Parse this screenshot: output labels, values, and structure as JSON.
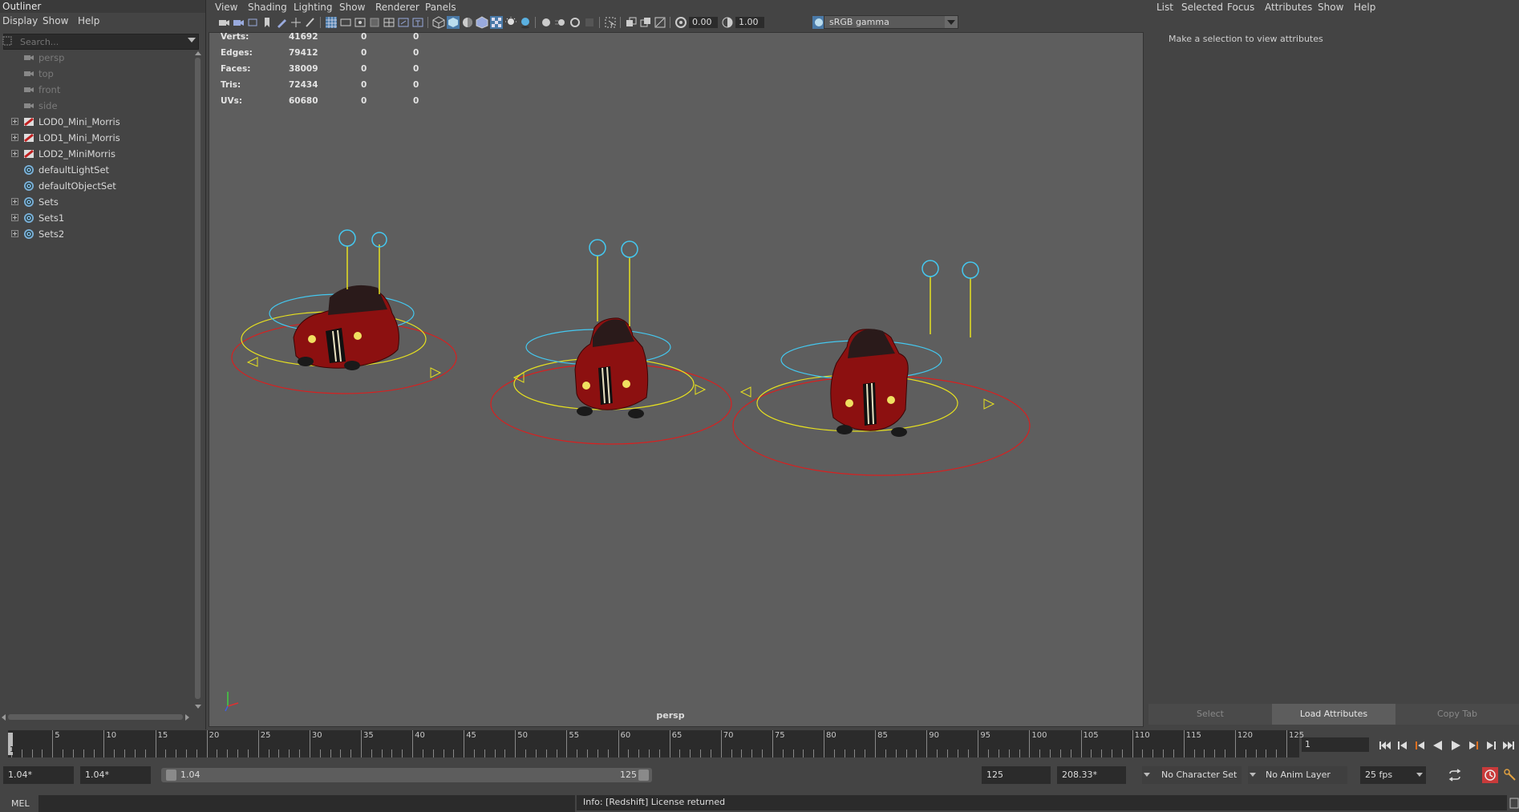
{
  "outliner": {
    "title": "Outliner",
    "menu": [
      "Display",
      "Show",
      "Help"
    ],
    "search_placeholder": "Search...",
    "items": [
      {
        "label": "persp",
        "icon": "camera-icon",
        "expandable": false,
        "dim": true
      },
      {
        "label": "top",
        "icon": "camera-icon",
        "expandable": false,
        "dim": true
      },
      {
        "label": "front",
        "icon": "camera-icon",
        "expandable": false,
        "dim": true
      },
      {
        "label": "side",
        "icon": "camera-icon",
        "expandable": false,
        "dim": true
      },
      {
        "label": "LOD0_Mini_Morris",
        "icon": "lod-group-icon",
        "expandable": true,
        "dim": false
      },
      {
        "label": "LOD1_Mini_Morris",
        "icon": "lod-group-icon",
        "expandable": true,
        "dim": false
      },
      {
        "label": "LOD2_MiniMorris",
        "icon": "lod-group-icon",
        "expandable": true,
        "dim": false
      },
      {
        "label": "defaultLightSet",
        "icon": "set-icon",
        "expandable": false,
        "dim": false
      },
      {
        "label": "defaultObjectSet",
        "icon": "set-icon",
        "expandable": false,
        "dim": false
      },
      {
        "label": "Sets",
        "icon": "set-icon",
        "expandable": true,
        "dim": false
      },
      {
        "label": "Sets1",
        "icon": "set-icon",
        "expandable": true,
        "dim": false
      },
      {
        "label": "Sets2",
        "icon": "set-icon",
        "expandable": true,
        "dim": false
      }
    ]
  },
  "viewport": {
    "menu": [
      "View",
      "Shading",
      "Lighting",
      "Show",
      "Renderer",
      "Panels"
    ],
    "exposure": "0.00",
    "gamma": "1.00",
    "colorspace": "sRGB gamma",
    "camera_label": "persp",
    "hud": [
      {
        "label": "Verts:",
        "values": [
          "41692",
          "0",
          "0"
        ]
      },
      {
        "label": "Edges:",
        "values": [
          "79412",
          "0",
          "0"
        ]
      },
      {
        "label": "Faces:",
        "values": [
          "38009",
          "0",
          "0"
        ]
      },
      {
        "label": "Tris:",
        "values": [
          "72434",
          "0",
          "0"
        ]
      },
      {
        "label": "UVs:",
        "values": [
          "60680",
          "0",
          "0"
        ]
      }
    ]
  },
  "attribute_editor": {
    "menu": [
      "List",
      "Selected",
      "Focus",
      "Attributes",
      "Show",
      "Help"
    ],
    "message": "Make a selection to view attributes",
    "buttons": {
      "select": "Select",
      "load": "Load Attributes",
      "copy": "Copy Tab"
    }
  },
  "timeslider": {
    "ticks": [
      "5",
      "10",
      "15",
      "20",
      "25",
      "30",
      "35",
      "40",
      "45",
      "50",
      "55",
      "60",
      "65",
      "70",
      "75",
      "80",
      "85",
      "90",
      "95",
      "100",
      "105",
      "110",
      "115",
      "120",
      "125"
    ],
    "current": "1",
    "current_frame_field": "1"
  },
  "rangeslider": {
    "start": "1.04*",
    "playback_start": "1.04*",
    "range_start_label": "1.04",
    "range_end_label": "125",
    "playback_end": "125",
    "end": "208.33*",
    "character_set": "No Character Set",
    "anim_layer": "No Anim Layer",
    "fps": "25 fps"
  },
  "cmdline": {
    "mel_label": "MEL",
    "info": "Info:  [Redshift] License returned"
  },
  "colors": {
    "bg": "#444444",
    "viewport_bg": "#5e5e5e",
    "field_bg": "#2b2b2b",
    "car_red": "#9c1414",
    "ring_red": "#d82020",
    "ring_yellow": "#e6e020",
    "ring_cyan": "#44c8f0"
  }
}
